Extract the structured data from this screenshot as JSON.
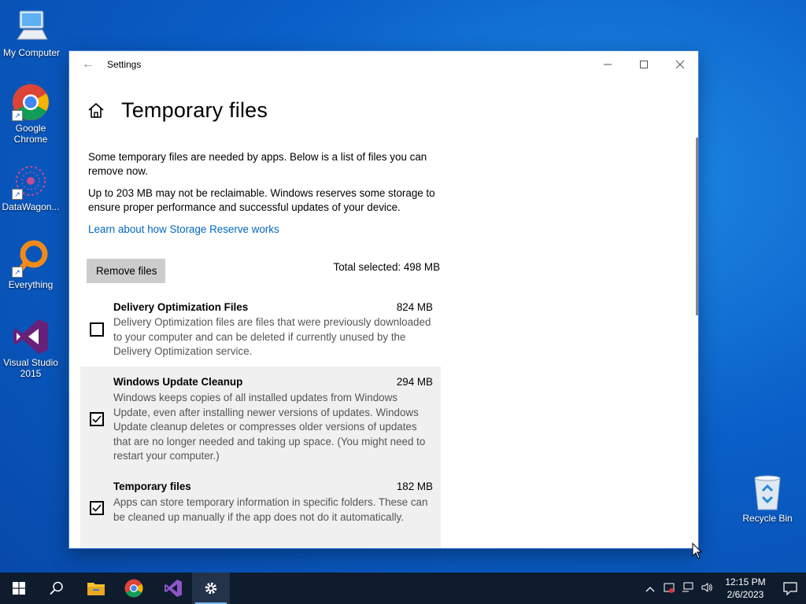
{
  "desktop": {
    "icons": [
      {
        "label": "My Computer",
        "icon": "computer-icon"
      },
      {
        "label": "Google Chrome",
        "icon": "chrome-icon"
      },
      {
        "label": "DataWagon...",
        "icon": "datawagon-icon"
      },
      {
        "label": "Everything",
        "icon": "everything-icon"
      },
      {
        "label": "Visual Studio 2015",
        "icon": "visual-studio-icon"
      },
      {
        "label": "Recycle Bin",
        "icon": "recycle-bin-icon"
      }
    ]
  },
  "window": {
    "title": "Settings",
    "page_title": "Temporary files",
    "intro": "Some temporary files are needed by apps. Below is a list of files you can remove now.",
    "reserve_note": "Up to 203 MB may not be reclaimable. Windows reserves some storage to ensure proper performance and successful updates of your device.",
    "learn_link": "Learn about how Storage Reserve works",
    "remove_button": "Remove files",
    "total_selected": "Total selected: 498 MB",
    "items": [
      {
        "name": "Delivery Optimization Files",
        "size": "824 MB",
        "checked": false,
        "description": "Delivery Optimization files are files that were previously downloaded to your computer and can be deleted if currently unused by the Delivery Optimization service."
      },
      {
        "name": "Windows Update Cleanup",
        "size": "294 MB",
        "checked": true,
        "description": "Windows keeps copies of all installed updates from Windows Update, even after installing newer versions of updates. Windows Update cleanup deletes or compresses older versions of updates that are no longer needed and taking up space. (You might need to restart your computer.)"
      },
      {
        "name": "Temporary files",
        "size": "182 MB",
        "checked": true,
        "description": "Apps can store temporary information in specific folders. These can be cleaned up manually if the app does not do it automatically."
      }
    ]
  },
  "taskbar": {
    "apps": [
      "start-icon",
      "search-icon",
      "file-explorer-icon",
      "chrome-icon",
      "visual-studio-icon",
      "settings-icon"
    ],
    "time": "12:15 PM",
    "date": "2/6/2023"
  },
  "colors": {
    "accent": "#0067c0",
    "taskbar": "#0f1c2e",
    "selected_row": "#f0f0f0"
  }
}
